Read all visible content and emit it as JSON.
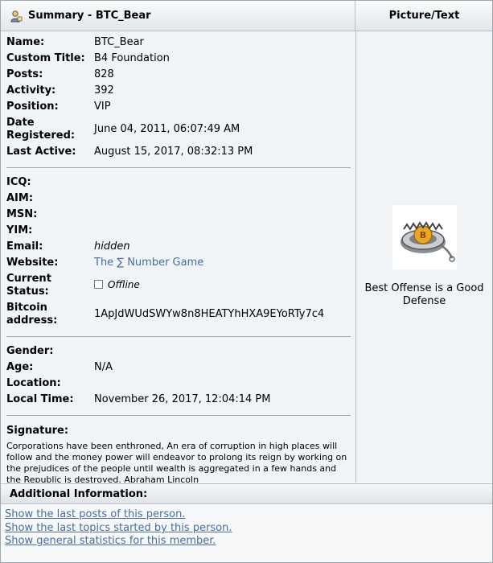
{
  "header": {
    "summary_title": "Summary - BTC_Bear",
    "picture_title": "Picture/Text"
  },
  "profile": {
    "name_label": "Name:",
    "name": "BTC_Bear",
    "custom_title_label": "Custom Title:",
    "custom_title": "B4 Foundation",
    "posts_label": "Posts:",
    "posts": "828",
    "activity_label": "Activity:",
    "activity": "392",
    "position_label": "Position:",
    "position": "VIP",
    "date_registered_label_1": "Date",
    "date_registered_label_2": "Registered:",
    "date_registered": "June 04, 2011, 06:07:49 AM",
    "last_active_label": "Last Active:",
    "last_active": "August 15, 2017, 08:32:13 PM"
  },
  "contact": {
    "icq_label": "ICQ:",
    "aim_label": "AIM:",
    "msn_label": "MSN:",
    "yim_label": "YIM:",
    "email_label": "Email:",
    "email": "hidden",
    "website_label": "Website:",
    "website": "The ∑ Number Game",
    "status_label_1": "Current",
    "status_label_2": "Status:",
    "status": "Offline",
    "bitcoin_label_1": "Bitcoin",
    "bitcoin_label_2": "address:",
    "bitcoin": "1ApJdWUdSWYw8n8HEATYhHXA9EYoRTy7c4"
  },
  "personal": {
    "gender_label": "Gender:",
    "age_label": "Age:",
    "age": "N/A",
    "location_label": "Location:",
    "local_time_label": "Local Time:",
    "local_time": "November 26, 2017, 12:04:14 PM"
  },
  "signature": {
    "label": "Signature:",
    "text": "Corporations have been enthroned, An era of corruption in high places will follow and the money power will endeavor to prolong its reign by working on the prejudices of the people until wealth is aggregated in a few hands and the Republic is destroyed.   Abraham Lincoln"
  },
  "picture": {
    "text": "Best Offense is a Good Defense",
    "icon": "bear-trap-coin-icon"
  },
  "additional": {
    "title": "Additional Information:",
    "links": [
      "Show the last posts of this person.",
      "Show the last topics started by this person.",
      "Show general statistics for this member."
    ]
  },
  "colors": {
    "panel_bg": "#f0f4f7",
    "link": "#4a6d9a",
    "border": "#b5bfca"
  }
}
